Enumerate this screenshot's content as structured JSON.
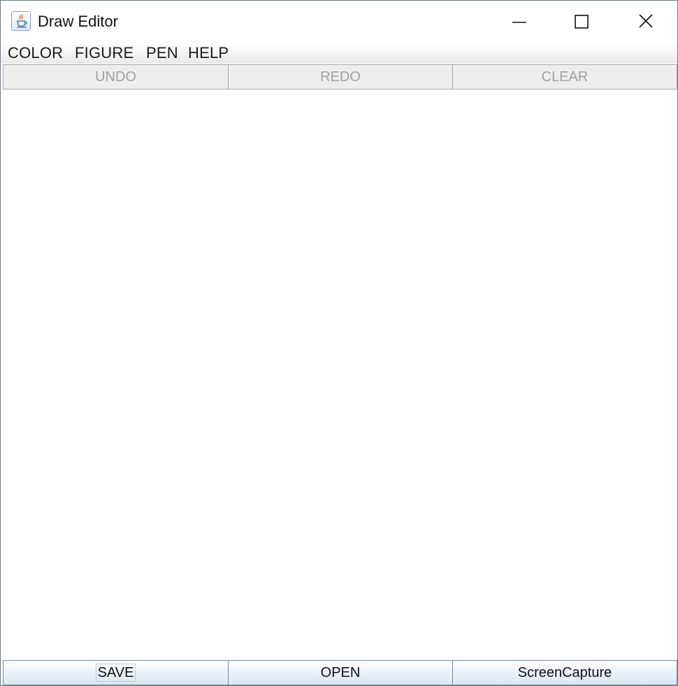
{
  "window": {
    "title": "Draw Editor",
    "app_icon": "java-cup-icon",
    "controls": {
      "minimize": "minimize-icon",
      "maximize": "maximize-icon",
      "close": "close-icon"
    }
  },
  "menubar": {
    "items": [
      {
        "label": "COLOR"
      },
      {
        "label": "FIGURE"
      },
      {
        "label": "PEN"
      },
      {
        "label": "HELP"
      }
    ]
  },
  "toolbar": {
    "undo_label": "UNDO",
    "redo_label": "REDO",
    "clear_label": "CLEAR",
    "state": "disabled"
  },
  "bottombar": {
    "save_label": "SAVE",
    "open_label": "OPEN",
    "capture_label": "ScreenCapture",
    "focused": "SAVE"
  },
  "colors": {
    "disabled_text": "#a0a0a0",
    "button_border": "#7a8a99",
    "canvas": "#ffffff"
  }
}
